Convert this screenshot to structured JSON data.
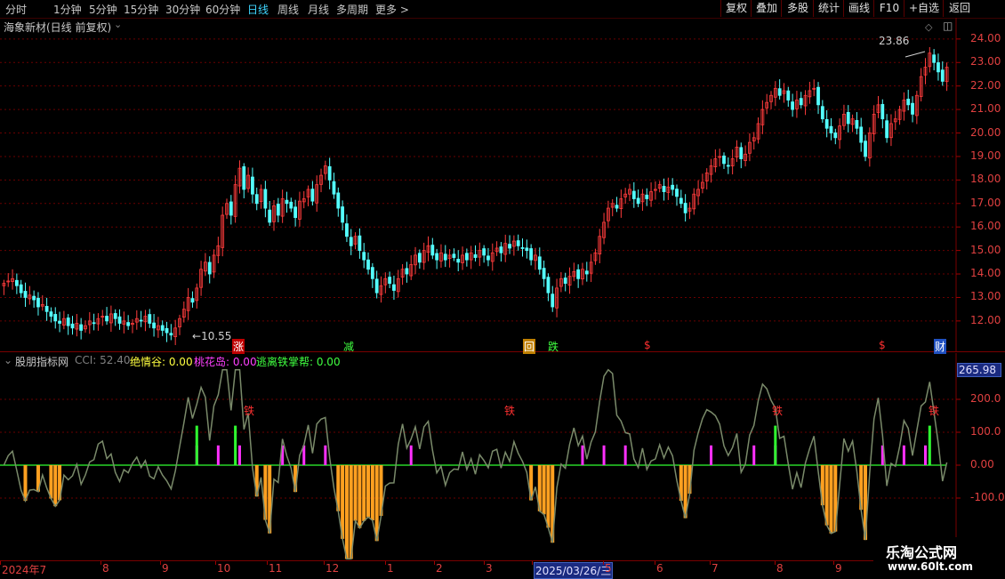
{
  "toolbar": {
    "periods": [
      "分时",
      "1分钟",
      "5分钟",
      "15分钟",
      "30分钟",
      "60分钟",
      "日线",
      "周线",
      "月线",
      "多周期",
      "更多 >"
    ],
    "active_period": "日线",
    "right_buttons": [
      "复权",
      "叠加",
      "多股",
      "统计",
      "画线",
      "F10",
      "+自选",
      "返回"
    ]
  },
  "main": {
    "title": "海象新材(日线 前复权)",
    "high_label": "23.86",
    "low_label": "10.55",
    "y_ticks": [
      "24.00",
      "23.00",
      "22.00",
      "21.00",
      "20.00",
      "19.00",
      "18.00",
      "17.00",
      "16.00",
      "15.00",
      "14.00",
      "13.00",
      "12.00"
    ],
    "markers": [
      {
        "text": "涨",
        "color": "#ffffff",
        "bg": "#c00000"
      },
      {
        "text": "减",
        "color": "#40ff40",
        "bg": ""
      },
      {
        "text": "回",
        "color": "#ffffff",
        "bg": "#c08000"
      },
      {
        "text": "跌",
        "color": "#40ff40",
        "bg": ""
      },
      {
        "text": "$",
        "color": "#ff3030",
        "bg": ""
      },
      {
        "text": "$",
        "color": "#ff3030",
        "bg": ""
      },
      {
        "text": "财",
        "color": "#ffffff",
        "bg": "#2050c0"
      }
    ]
  },
  "indicator": {
    "name": "股朋指标网",
    "fields": [
      {
        "label": "CCI: 52.40",
        "color": "#808080"
      },
      {
        "label": "绝情谷: 0.00",
        "color": "#ffff40"
      },
      {
        "label": "桃花岛: 0.00",
        "color": "#ff40ff"
      },
      {
        "label": "逃离铁掌帮: 0.00",
        "color": "#40ff40"
      }
    ],
    "current_value": "265.98",
    "y_ticks": [
      "200.0",
      "100.0",
      "0.00",
      "-100.0"
    ],
    "signal_text": "铁"
  },
  "time_axis": {
    "labels": [
      "2024年7",
      "8",
      "9",
      "10",
      "11",
      "12",
      "1",
      "2",
      "3",
      "2025/03/26/三",
      "5",
      "6",
      "7",
      "8",
      "9"
    ]
  },
  "watermark": {
    "title": "乐淘公式网",
    "url": "www.60lt.com"
  },
  "colors": {
    "up": "#ff3c3c",
    "down": "#54ffff",
    "grid": "#6a0000",
    "cci": "#7a8a6a",
    "orange": "#ffa020",
    "magenta": "#ff30ff",
    "green": "#30ff30"
  },
  "chart_data": {
    "type": "candlestick",
    "ylim": [
      11.2,
      24.6
    ],
    "closes": [
      13.6,
      13.7,
      13.8,
      13.5,
      13.2,
      13.0,
      13.1,
      12.9,
      12.6,
      12.7,
      12.4,
      12.2,
      12.0,
      11.9,
      12.1,
      11.8,
      11.7,
      11.9,
      11.6,
      11.8,
      12.0,
      11.9,
      12.1,
      12.2,
      12.0,
      12.3,
      12.1,
      11.9,
      12.0,
      11.8,
      11.9,
      12.1,
      12.0,
      12.2,
      11.9,
      11.7,
      11.8,
      11.6,
      11.5,
      11.4,
      11.7,
      12.1,
      12.5,
      13.0,
      12.8,
      13.4,
      14.2,
      14.5,
      14.0,
      14.8,
      15.2,
      16.5,
      17.0,
      16.5,
      17.8,
      18.5,
      17.6,
      18.2,
      17.4,
      17.0,
      17.6,
      16.8,
      16.2,
      16.9,
      16.5,
      17.2,
      17.0,
      16.8,
      16.4,
      17.1,
      17.2,
      17.6,
      17.1,
      17.8,
      18.2,
      18.6,
      18.0,
      17.4,
      16.8,
      16.2,
      15.6,
      15.2,
      15.6,
      15.0,
      14.6,
      14.2,
      13.8,
      13.2,
      13.5,
      13.8,
      13.6,
      13.3,
      13.8,
      14.2,
      14.0,
      14.4,
      14.8,
      14.5,
      15.0,
      15.2,
      14.8,
      14.6,
      14.9,
      14.6,
      14.8,
      14.7,
      14.5,
      14.8,
      14.6,
      14.9,
      14.7,
      15.0,
      14.8,
      14.6,
      14.9,
      15.1,
      14.9,
      15.3,
      15.1,
      15.4,
      15.2,
      15.1,
      15.0,
      14.6,
      14.8,
      14.2,
      13.8,
      13.2,
      12.6,
      13.4,
      13.8,
      13.6,
      13.9,
      14.1,
      13.8,
      14.2,
      14.0,
      14.5,
      14.9,
      15.6,
      16.2,
      16.8,
      17.0,
      16.8,
      17.2,
      17.4,
      17.6,
      17.2,
      17.0,
      17.4,
      17.2,
      17.5,
      17.6,
      17.8,
      17.5,
      17.7,
      17.6,
      17.3,
      17.0,
      16.6,
      16.8,
      17.4,
      17.6,
      17.9,
      18.3,
      18.6,
      18.9,
      19.0,
      18.7,
      18.6,
      18.9,
      19.4,
      18.9,
      19.1,
      19.6,
      19.8,
      20.4,
      21.0,
      21.3,
      21.6,
      21.9,
      21.6,
      21.8,
      21.4,
      21.0,
      21.4,
      21.2,
      21.6,
      21.8,
      21.9,
      21.2,
      20.6,
      20.2,
      20.0,
      19.8,
      20.3,
      20.8,
      20.4,
      20.6,
      20.2,
      19.6,
      19.0,
      20.0,
      20.8,
      21.2,
      20.6,
      19.8,
      20.4,
      20.6,
      21.0,
      21.4,
      21.2,
      20.8,
      21.6,
      22.4,
      22.8,
      23.4,
      23.0,
      22.6,
      22.2,
      22.8
    ]
  }
}
